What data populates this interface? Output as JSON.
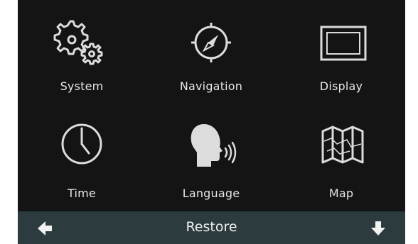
{
  "menu": {
    "items": [
      {
        "label": "System",
        "icon": "gears-icon"
      },
      {
        "label": "Navigation",
        "icon": "compass-icon"
      },
      {
        "label": "Display",
        "icon": "display-icon"
      },
      {
        "label": "Time",
        "icon": "clock-icon"
      },
      {
        "label": "Language",
        "icon": "speaking-head-icon"
      },
      {
        "label": "Map",
        "icon": "folded-map-icon"
      }
    ]
  },
  "bottom_bar": {
    "title": "Restore",
    "left_icon": "back-arrow-icon",
    "right_icon": "down-arrow-icon"
  },
  "colors": {
    "background": "#141414",
    "bar": "#2c3b3d",
    "text": "#e6e6e6"
  }
}
